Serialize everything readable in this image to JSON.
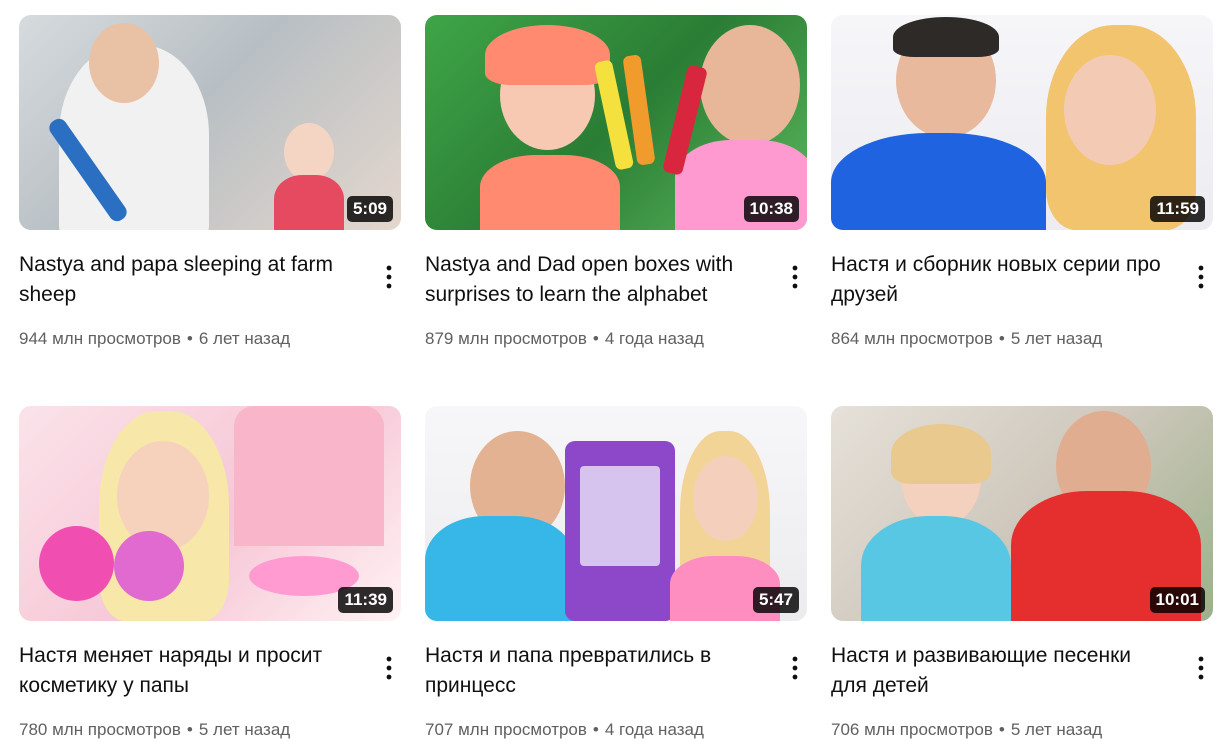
{
  "videos": [
    {
      "title": "Nastya and papa sleeping at farm sheep",
      "views": "944 млн просмотров",
      "age": "6 лет назад",
      "duration": "5:09",
      "colors": {
        "bg": "#c9cfd3",
        "accent1": "#2a6fc2",
        "accent2": "#f4d5c4",
        "accent3": "#e64a60"
      }
    },
    {
      "title": "Nastya and Dad open boxes with surprises to learn the alphabet",
      "views": "879 млн просмотров",
      "age": "4 года назад",
      "duration": "10:38",
      "colors": {
        "bg": "#2e8a3a",
        "accent1": "#ff8a70",
        "accent2": "#f7c9b2",
        "accent3": "#ff9ad1"
      }
    },
    {
      "title": "Настя и сборник новых серии про друзей",
      "views": "864 млн просмотров",
      "age": "5 лет назад",
      "duration": "11:59",
      "colors": {
        "bg": "#f2f2f6",
        "accent1": "#1f63e0",
        "accent2": "#f3cbb4",
        "accent3": "#f2c46d"
      }
    },
    {
      "title": "Настя меняет наряды и просит косметику у папы",
      "views": "780 млн просмотров",
      "age": "5 лет назад",
      "duration": "11:39",
      "colors": {
        "bg": "#f7d3df",
        "accent1": "#f04fb1",
        "accent2": "#f6d2bd",
        "accent3": "#f7e7a8"
      }
    },
    {
      "title": "Настя и папа превратились в принцесс",
      "views": "707 млн просмотров",
      "age": "4 года назад",
      "duration": "5:47",
      "colors": {
        "bg": "#f3f3f5",
        "accent1": "#36b7e8",
        "accent2": "#8d48c9",
        "accent3": "#ff8ec0"
      }
    },
    {
      "title": "Настя и развивающие песенки для детей",
      "views": "706 млн просмотров",
      "age": "5 лет назад",
      "duration": "10:01",
      "colors": {
        "bg": "#d9d4cc",
        "accent1": "#58c7e3",
        "accent2": "#e52f2f",
        "accent3": "#f4d0bf"
      }
    }
  ],
  "meta_separator": "•",
  "icons": {
    "menu": "more-vert-icon"
  }
}
